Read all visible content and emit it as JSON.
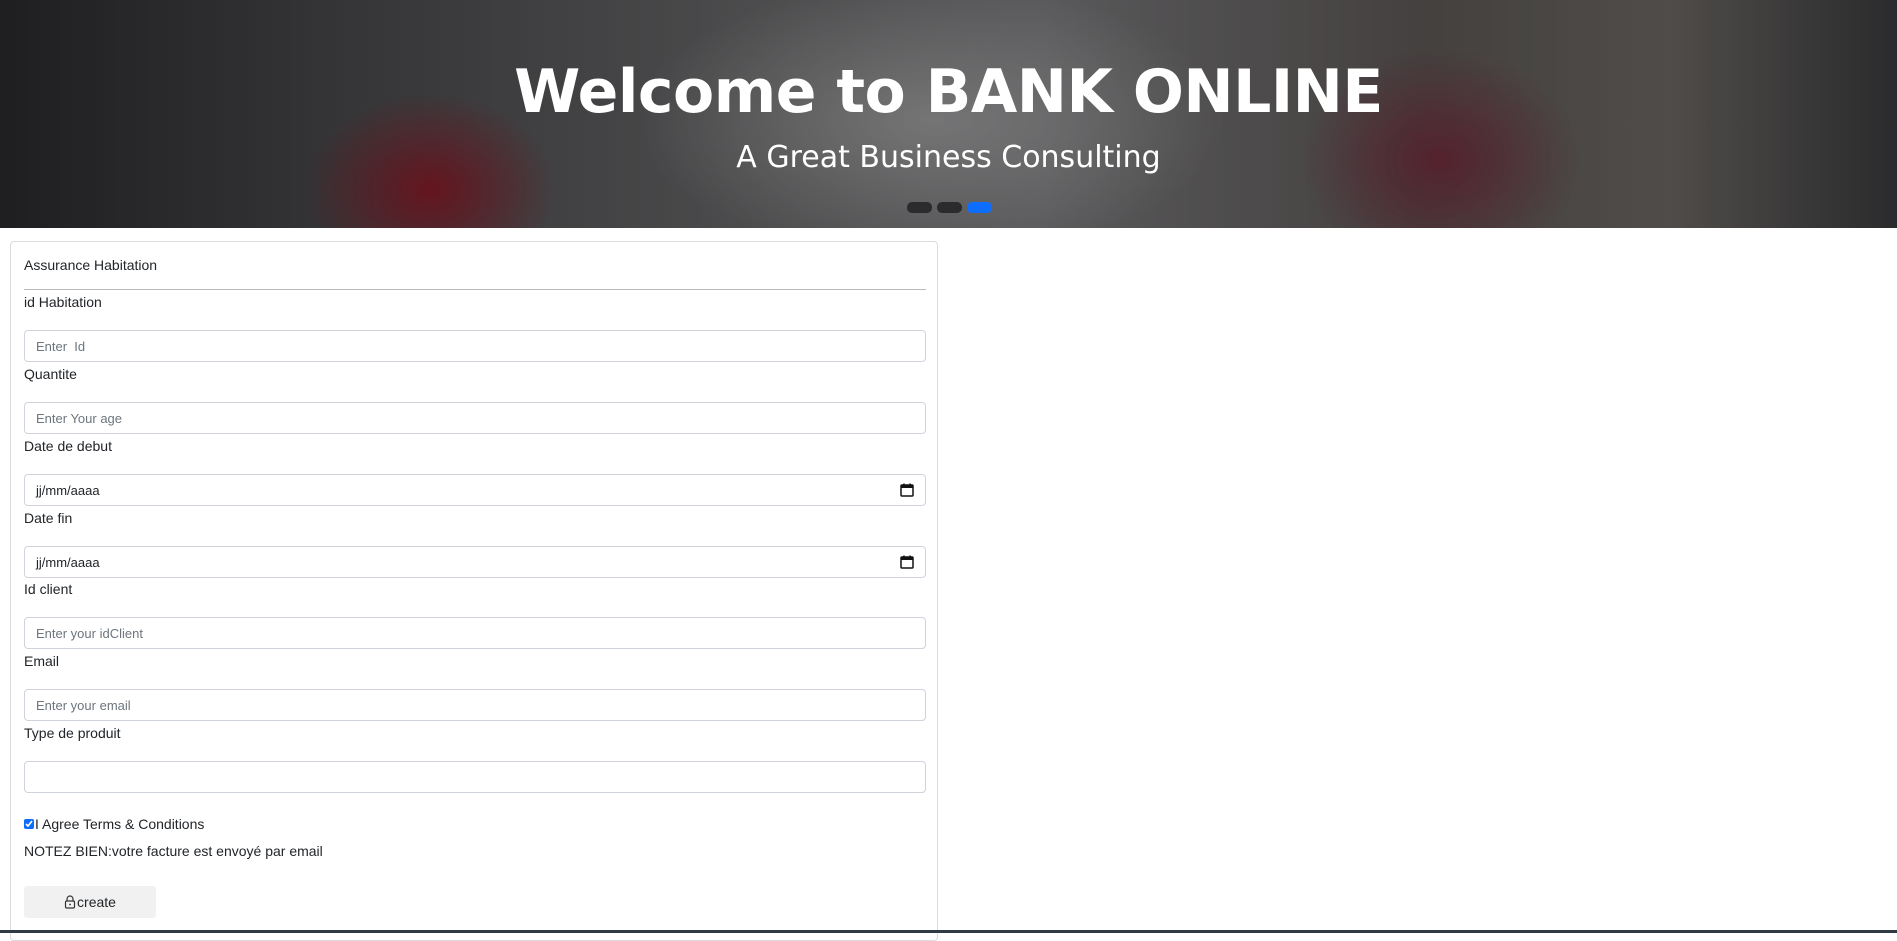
{
  "hero": {
    "title": "Welcome to BANK ONLINE",
    "subtitle": "A Great Business Consulting",
    "slides": 3,
    "active_slide": 3,
    "active_indicator_color": "#0d6efd"
  },
  "form": {
    "header": "Assurance Habitation",
    "fields": {
      "id_habitation": {
        "label": "id Habitation",
        "placeholder": "Enter  Id",
        "value": ""
      },
      "quantite": {
        "label": "Quantite",
        "placeholder": "Enter Your age",
        "value": ""
      },
      "date_debut": {
        "label": "Date de debut",
        "value": "jj/mm/aaaa"
      },
      "date_fin": {
        "label": "Date fin",
        "value": "jj/mm/aaaa"
      },
      "id_client": {
        "label": "Id client",
        "placeholder": "Enter your idClient",
        "value": ""
      },
      "email": {
        "label": "Email",
        "placeholder": "Enter your email",
        "value": ""
      },
      "type_produit": {
        "label": "Type de produit",
        "placeholder": "",
        "value": ""
      }
    },
    "terms": {
      "label": "I Agree Terms & Conditions",
      "checked": true
    },
    "notice": "NOTEZ BIEN:votre facture est envoyé par email",
    "submit": {
      "label": "create",
      "icon": "lock-icon"
    }
  }
}
